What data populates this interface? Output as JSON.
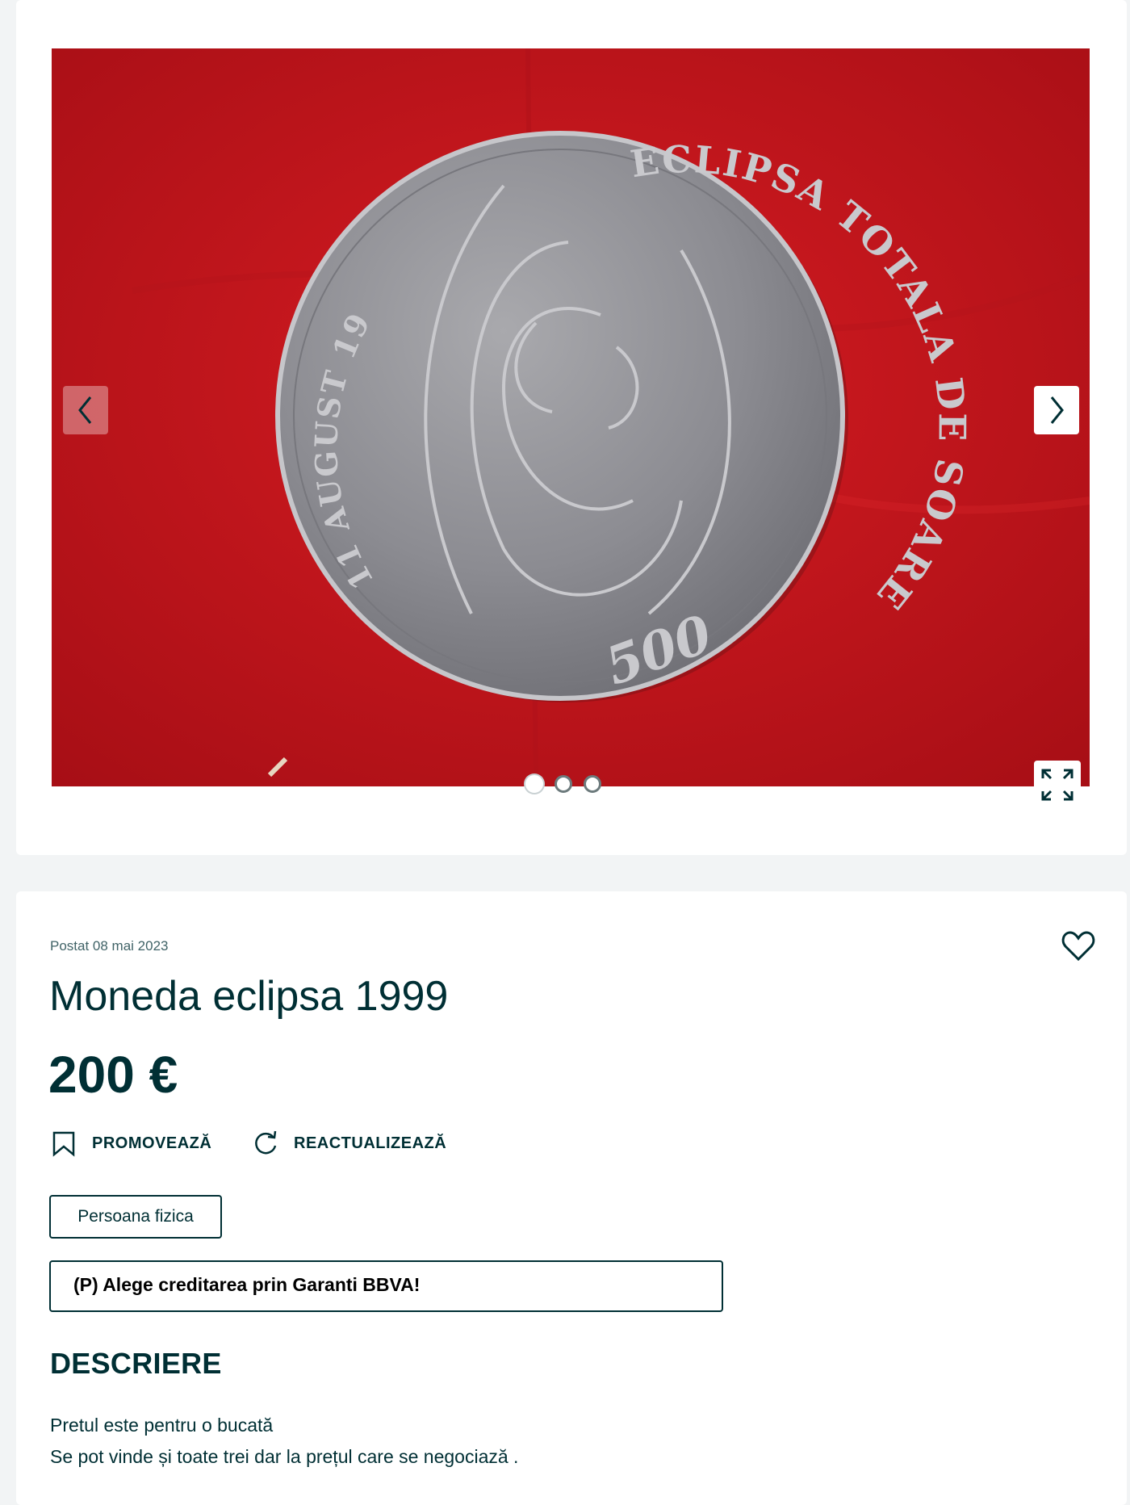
{
  "gallery": {
    "image_alt": "Moneda eclipsa 1999",
    "coin_text_top": "ECLIPSA TOTALA DE SOARE",
    "coin_text_left": "11 AUGUST 1999",
    "coin_denomination": "500",
    "slide_count": 3,
    "active_slide": 1
  },
  "listing": {
    "posted": "Postat 08 mai 2023",
    "title": "Moneda eclipsa 1999",
    "price": "200 €",
    "actions": {
      "promote": "PROMOVEAZĂ",
      "refresh": "REACTUALIZEAZĂ"
    },
    "seller_type": "Persoana fizica",
    "promo_banner": "(P) Alege creditarea prin Garanti BBVA!",
    "description_heading": "DESCRIERE",
    "description_lines": [
      "Pretul este pentru o bucată",
      "Se pot vinde și toate trei dar la prețul care se negociază ."
    ]
  },
  "icons": {
    "prev": "chevron-left-icon",
    "next": "chevron-right-icon",
    "expand": "expand-icon",
    "favorite": "heart-icon",
    "promote": "bookmark-icon",
    "refresh": "refresh-icon"
  },
  "colors": {
    "text": "#002f34",
    "page_bg": "#f2f4f5",
    "card_bg": "#ffffff",
    "photo_red": "#c2141b"
  }
}
